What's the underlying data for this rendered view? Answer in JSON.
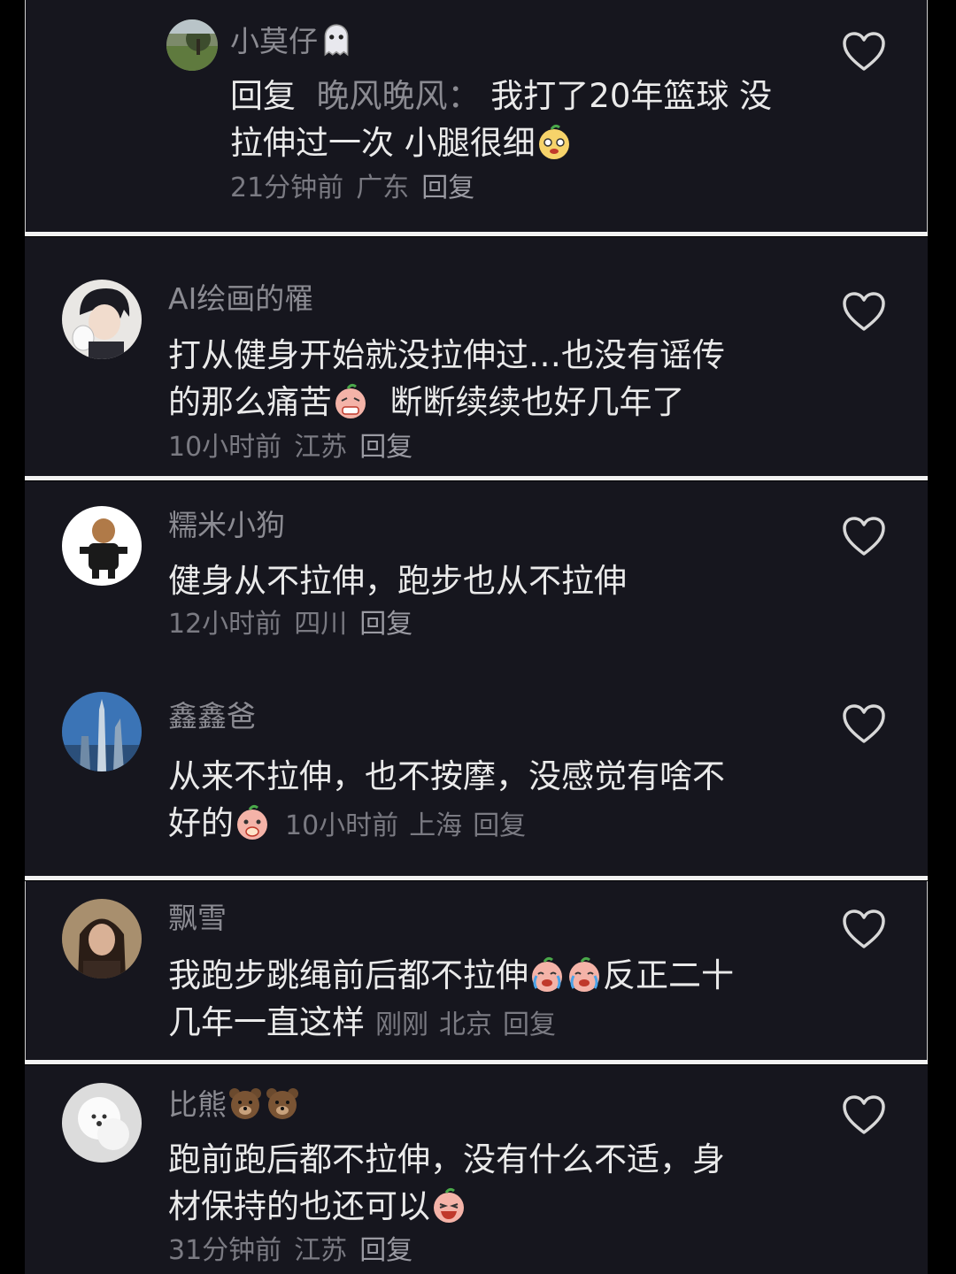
{
  "comments": [
    {
      "username": "小莫仔",
      "reply_prefix": "回复",
      "reply_target": "晚风晚风：",
      "line1": "我打了20年篮球 没",
      "line2": "拉伸过一次 小腿很细",
      "time": "21分钟前",
      "location": "广东",
      "reply": "回复"
    },
    {
      "username": "AI绘画的罹",
      "line1": "打从健身开始就没拉伸过…也没有谣传",
      "line2a": "的那么痛苦",
      "line2b": "断断续续也好几年了",
      "time": "10小时前",
      "location": "江苏",
      "reply": "回复"
    },
    {
      "username": "糯米小狗",
      "line1": "健身从不拉伸，跑步也从不拉伸",
      "time": "12小时前",
      "location": "四川",
      "reply": "回复"
    },
    {
      "username": "鑫鑫爸",
      "line1": "从来不拉伸，也不按摩，没感觉有啥不",
      "line2": "好的",
      "time": "10小时前",
      "location": "上海",
      "reply": "回复"
    },
    {
      "username": "飘雪",
      "line1": "我跑步跳绳前后都不拉伸",
      "line1b": "反正二十",
      "line2": "几年一直这样",
      "time": "刚刚",
      "location": "北京",
      "reply": "回复"
    },
    {
      "username": "比熊",
      "line1": "跑前跑后都不拉伸，没有什么不适，身",
      "line2": "材保持的也还可以",
      "time": "31分钟前",
      "location": "江苏",
      "reply": "回复"
    }
  ],
  "icons": {
    "like": "heart-outline-icon",
    "ghost": "ghost-emoji",
    "bear": "bear-emoji"
  },
  "colors": {
    "background": "#000000",
    "panel": "#16161e",
    "username": "#8b8b92",
    "text": "#eaeaea",
    "meta": "#7a7a82"
  }
}
